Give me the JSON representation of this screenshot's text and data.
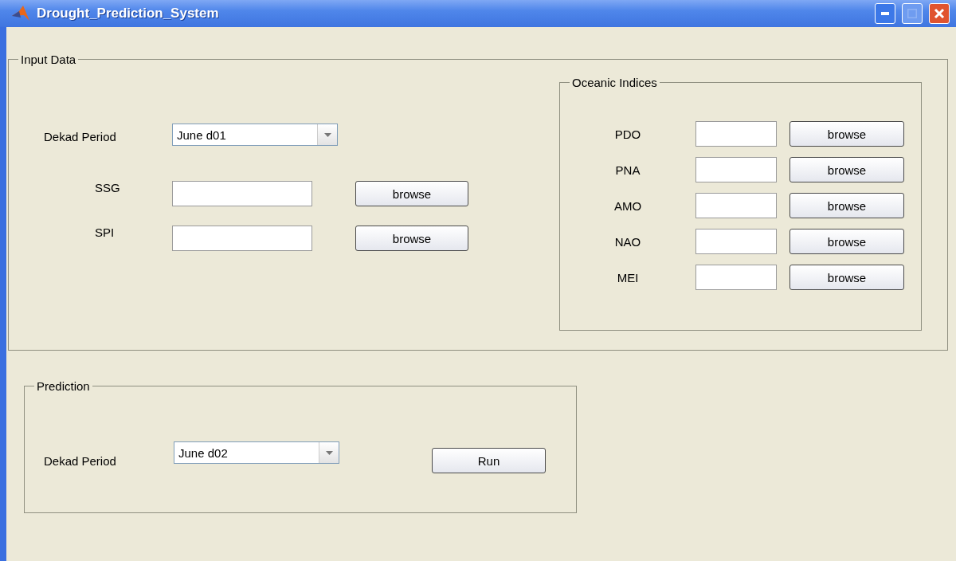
{
  "window": {
    "title": "Drought_Prediction_System"
  },
  "input_data": {
    "title": "Input Data",
    "dekad": {
      "label": "Dekad Period",
      "value": "June d01"
    },
    "series": [
      {
        "label": "SSG",
        "button": "browse"
      },
      {
        "label": "SPI",
        "button": "browse"
      }
    ],
    "oceanic": {
      "title": "Oceanic Indices",
      "indices": [
        {
          "label": "PDO",
          "button": "browse"
        },
        {
          "label": "PNA",
          "button": "browse"
        },
        {
          "label": "AMO",
          "button": "browse"
        },
        {
          "label": "NAO",
          "button": "browse"
        },
        {
          "label": "MEI",
          "button": "browse"
        }
      ]
    }
  },
  "prediction": {
    "title": "Prediction",
    "dekad": {
      "label": "Dekad Period",
      "value": "June d02"
    },
    "button": "Run"
  }
}
